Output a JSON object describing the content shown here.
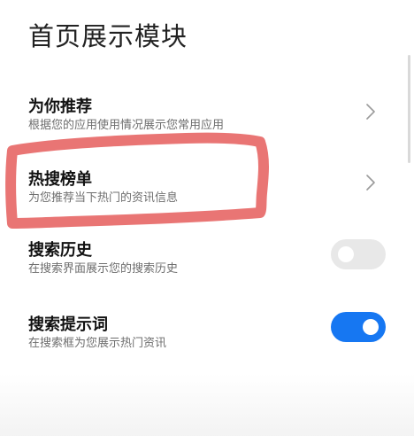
{
  "page": {
    "title": "首页展示模块"
  },
  "items": [
    {
      "title": "为你推荐",
      "subtitle": "根据您的应用使用情况展示您常用应用",
      "control": "chevron"
    },
    {
      "title": "热搜榜单",
      "subtitle": "为您推荐当下热门的资讯信息",
      "control": "chevron",
      "highlighted": true
    },
    {
      "title": "搜索历史",
      "subtitle": "在搜索界面展示您的搜索历史",
      "control": "toggle",
      "enabled": false
    },
    {
      "title": "搜索提示词",
      "subtitle": "在搜索框为您展示热门资讯",
      "control": "toggle",
      "enabled": true
    }
  ],
  "colors": {
    "accent": "#1677f2",
    "toggle_off": "#e8e8e8",
    "highlight_marker": "#e0403f",
    "subtitle_text": "#6e6e6e"
  },
  "icons": {
    "chevron": "chevron-right-icon"
  }
}
